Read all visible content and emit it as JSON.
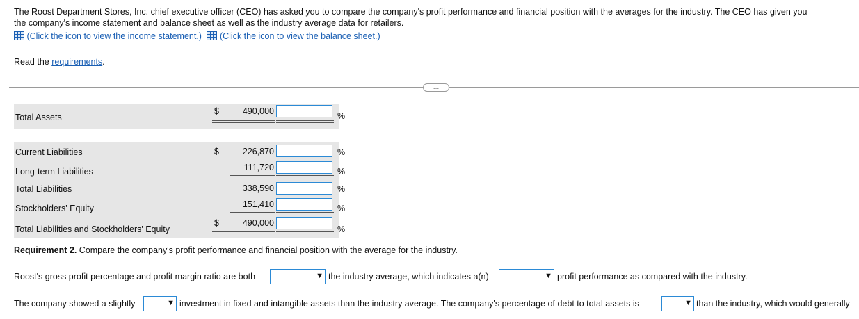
{
  "intro": {
    "line1": "The Roost Department Stores, Inc. chief executive officer (CEO) has asked you to compare the company's profit performance and financial position with the averages for the industry. The CEO has given you",
    "line2": "the company's income statement and balance sheet as well as the industry average data for retailers.",
    "income_link": "(Click the icon to view the income statement.)",
    "balance_link": "(Click the icon to view the balance sheet.)"
  },
  "read": {
    "prefix": "Read the ",
    "link": "requirements",
    "suffix": "."
  },
  "ellipsis": "…",
  "table": {
    "total_assets": {
      "label": "Total Assets",
      "currency": "$",
      "value": "490,000",
      "pct": "%"
    },
    "rows": [
      {
        "label": "Current Liabilities",
        "currency": "$",
        "value": "226,870",
        "pct": "%"
      },
      {
        "label": "Long-term Liabilities",
        "currency": "",
        "value": "111,720",
        "pct": "%"
      },
      {
        "label": "Total Liabilities",
        "currency": "",
        "value": "338,590",
        "pct": "%"
      },
      {
        "label": "Stockholders' Equity",
        "currency": "",
        "value": "151,410",
        "pct": "%"
      },
      {
        "label": "Total Liabilities and Stockholders' Equity",
        "currency": "$",
        "value": "490,000",
        "pct": "%"
      }
    ]
  },
  "req2": {
    "bold": "Requirement 2.",
    "text": " Compare the company's profit performance and financial position with the average for the industry."
  },
  "sentence1": {
    "part1": "Roost's gross profit percentage and profit margin ratio are both",
    "part2": "the industry average, which indicates a(n)",
    "part3": "profit performance as compared with the industry."
  },
  "sentence2": {
    "part1": "The company showed a slightly",
    "part2": "investment in fixed and intangible assets than the industry average. The company's percentage of debt to total assets is",
    "part3": "than the industry, which would generally"
  },
  "icons": {
    "table": "table-grid-icon",
    "dropdown": "dropdown-arrow-icon"
  },
  "colors": {
    "link": "#1a5fb4",
    "input_border": "#2b8ad6",
    "band": "#e6e6e6"
  }
}
